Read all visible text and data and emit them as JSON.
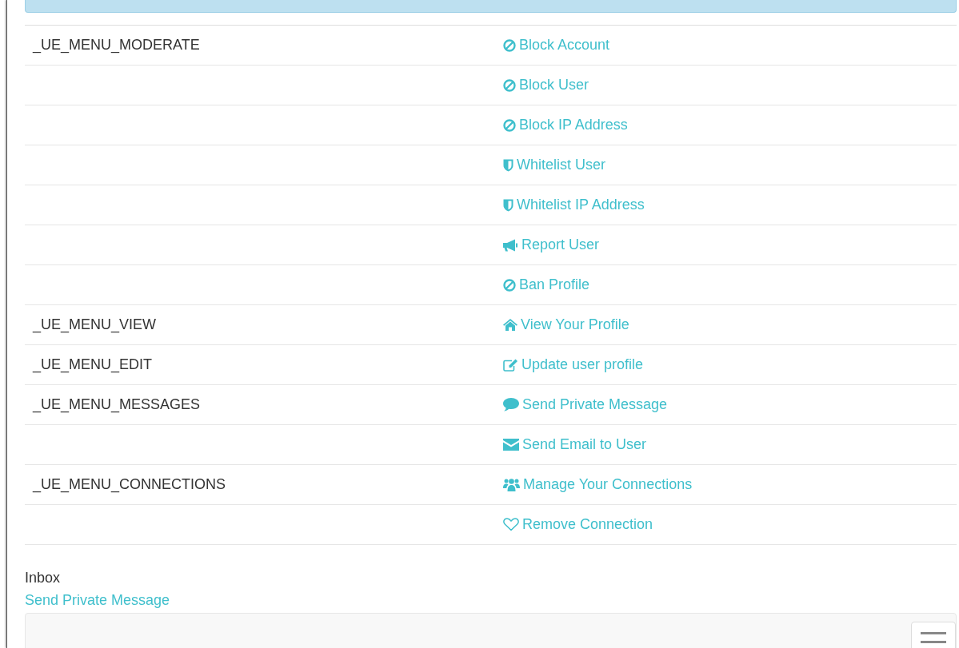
{
  "menu_table": {
    "rows": [
      {
        "group": "_UE_MENU_MODERATE",
        "kind": "ban",
        "action": "Block Account"
      },
      {
        "group": "",
        "kind": "ban",
        "action": "Block User"
      },
      {
        "group": "",
        "kind": "ban",
        "action": "Block IP Address"
      },
      {
        "group": "",
        "kind": "shield",
        "action": "Whitelist User"
      },
      {
        "group": "",
        "kind": "shield",
        "action": "Whitelist IP Address"
      },
      {
        "group": "",
        "kind": "bullhorn",
        "action": "Report User"
      },
      {
        "group": "",
        "kind": "ban",
        "action": "Ban Profile"
      },
      {
        "group": "_UE_MENU_VIEW",
        "kind": "home",
        "action": "View Your Profile"
      },
      {
        "group": "_UE_MENU_EDIT",
        "kind": "edit",
        "action": "Update user profile"
      },
      {
        "group": "_UE_MENU_MESSAGES",
        "kind": "comment",
        "action": "Send Private Message"
      },
      {
        "group": "",
        "kind": "envelope",
        "action": "Send Email to User"
      },
      {
        "group": "_UE_MENU_CONNECTIONS",
        "kind": "users",
        "action": "Manage Your Connections"
      },
      {
        "group": "",
        "kind": "heart",
        "action": "Remove Connection"
      }
    ]
  },
  "inbox": {
    "title": "Inbox",
    "link": "Send Private Message"
  }
}
